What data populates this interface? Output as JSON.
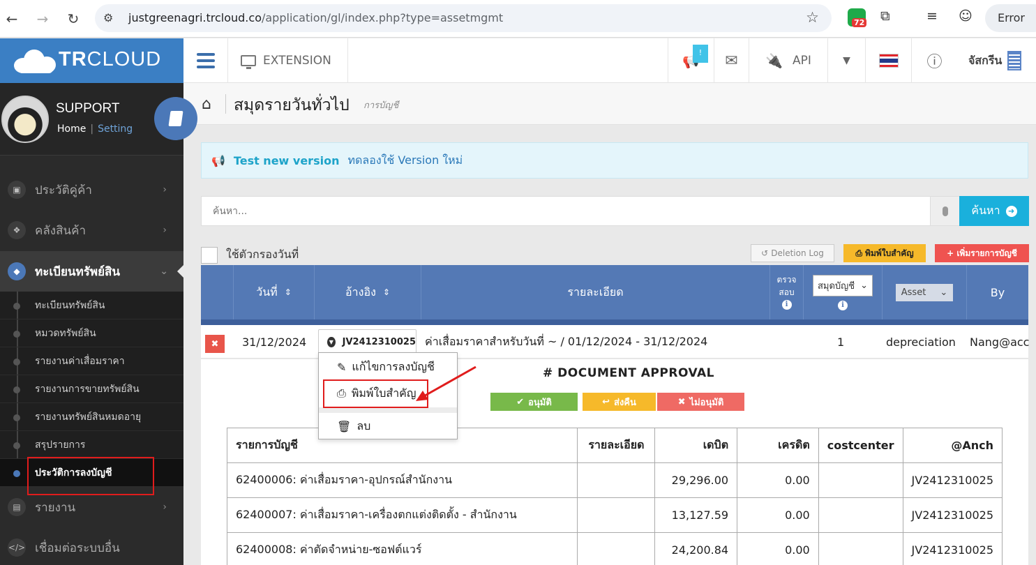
{
  "browser": {
    "url_host": "justgreenagri.trcloud.co",
    "url_path": "/application/gl/index.php?type=assetmgmt",
    "extension_badge": "72",
    "error_label": "Error"
  },
  "topbar": {
    "logo_bold": "TR",
    "logo_rest": "CLOUD",
    "extension_label": "EXTENSION",
    "notification_badge": "!",
    "api_label": "API",
    "company": "จัสกรีน"
  },
  "sidebar": {
    "user_name": "SUPPORT",
    "home_link": "Home",
    "setting_link": "Setting",
    "items": [
      {
        "label": "ประวัติคู่ค้า"
      },
      {
        "label": "คลังสินค้า"
      },
      {
        "label": "ทะเบียนทรัพย์สิน"
      },
      {
        "label": "รายงาน"
      },
      {
        "label": "เชื่อมต่อระบบอื่น"
      }
    ],
    "sub_items": [
      {
        "label": "ทะเบียนทรัพย์สิน"
      },
      {
        "label": "หมวดทรัพย์สิน"
      },
      {
        "label": "รายงานค่าเสื่อมราคา"
      },
      {
        "label": "รายงานการขายทรัพย์สิน"
      },
      {
        "label": "รายงานทรัพย์สินหมดอายุ"
      },
      {
        "label": "สรุปรายการ"
      },
      {
        "label": "ประวัติการลงบัญชี"
      }
    ]
  },
  "page": {
    "title": "สมุดรายวันทั่วไป",
    "subtitle": "การบัญชี",
    "alert_strong": "Test new version",
    "alert_text": "ทดลองใช้ Version ใหม่",
    "search_placeholder": "ค้นหา...",
    "search_button": "ค้นหา",
    "date_filter_label": "ใช้ตัวกรองวันที่",
    "deletion_log": "Deletion Log",
    "print_button": "พิมพ์ใบสำคัญ",
    "add_button": "+ เพิ่มรายการบัญชี"
  },
  "table": {
    "headers": {
      "date": "วันที่",
      "ref": "อ้างอิง",
      "detail": "รายละเอียด",
      "check_line1": "ตรวจ",
      "check_line2": "สอบ",
      "book_select": "สมุดบัญชี",
      "type_select": "Asset",
      "by": "By"
    },
    "row": {
      "date": "31/12/2024",
      "ref": "JV2412310025",
      "detail": "ค่าเสื่อมราคาสำหรับวันที่ ~ / 01/12/2024 - 31/12/2024",
      "book": "1",
      "type": "depreciation",
      "by": "Nang@acc"
    }
  },
  "dropdown": {
    "edit": "แก้ไขการลงบัญชี",
    "print": "พิมพ์ใบสำคัญ",
    "delete": "ลบ"
  },
  "approval": {
    "title": "# DOCUMENT APPROVAL",
    "approve": "อนุมัติ",
    "return": "ส่งคืน",
    "reject": "ไม่อนุมัติ"
  },
  "detail_table": {
    "headers": [
      "รายการบัญชี",
      "รายละเอียด",
      "เดบิต",
      "เครดิต",
      "costcenter",
      "@Anch"
    ],
    "rows": [
      {
        "account": "62400006: ค่าเสื่อมราคา-อุปกรณ์สำนักงาน",
        "detail": "",
        "debit": "29,296.00",
        "credit": "0.00",
        "cc": "",
        "anch": "JV2412310025"
      },
      {
        "account": "62400007: ค่าเสื่อมราคา-เครื่องตกแต่งติดตั้ง - สำนักงาน",
        "detail": "",
        "debit": "13,127.59",
        "credit": "0.00",
        "cc": "",
        "anch": "JV2412310025"
      },
      {
        "account": "62400008: ค่าตัดจำหน่าย-ซอฟต์แวร์",
        "detail": "",
        "debit": "24,200.84",
        "credit": "0.00",
        "cc": "",
        "anch": "JV2412310025"
      }
    ]
  }
}
